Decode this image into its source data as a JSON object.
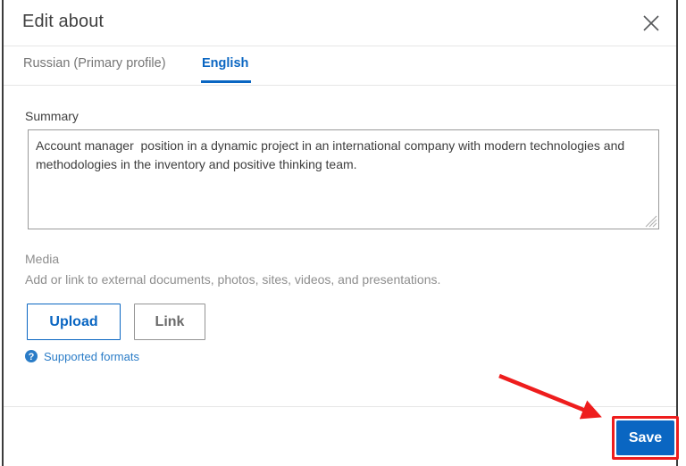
{
  "dialog": {
    "title": "Edit about",
    "close_label": "Close",
    "close_icon": "close-icon"
  },
  "tabs": [
    {
      "label": "Russian (Primary profile)",
      "active": false
    },
    {
      "label": "English",
      "active": true
    }
  ],
  "form": {
    "summary": {
      "label": "Summary",
      "value": "Account manager  position in a dynamic project in an international company with modern technologies and methodologies in the inventory and positive thinking team.",
      "placeholder": ""
    },
    "media": {
      "label": "Media",
      "description": "Add or link to external documents, photos, sites, videos, and presentations.",
      "upload_label": "Upload",
      "link_label": "Link",
      "supported_formats_label": "Supported formats",
      "supported_formats_icon": "help-circle-icon"
    }
  },
  "footer": {
    "save_label": "Save"
  },
  "annotation": {
    "arrow_color": "#ee1d1d",
    "highlight_color": "#ee1d1d"
  },
  "colors": {
    "accent_blue": "#0a66c2",
    "link_blue": "#2a7cc7",
    "text_dark": "#404040",
    "text_muted": "#8e8e8e",
    "border_gray": "#9a9a9a",
    "divider": "#e6e6e6"
  }
}
